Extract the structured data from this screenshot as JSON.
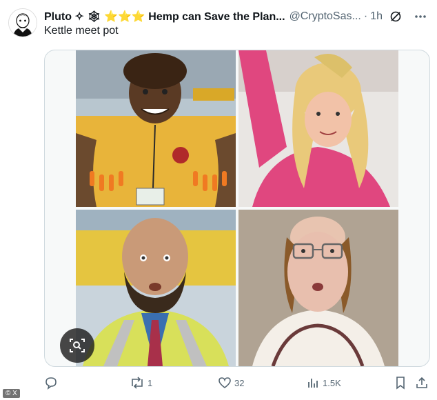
{
  "tweet": {
    "display_name": "Pluto ✧ 🕸 ⭐⭐⭐ Hemp can Save the Plan...",
    "handle": "@CryptoSas...",
    "dot": "·",
    "time": "1h",
    "text": "Kettle meet pot"
  },
  "media": {
    "photos": [
      {
        "name": "photo-top-left",
        "bg": "#e8b43a"
      },
      {
        "name": "photo-top-right",
        "bg": "#e0477f"
      },
      {
        "name": "photo-bottom-left",
        "bg": "#d8b83a"
      },
      {
        "name": "photo-bottom-right",
        "bg": "#c9b9a4"
      }
    ],
    "zoom_icon": "image-search-icon"
  },
  "actions": {
    "reply_count": "",
    "retweet_count": "1",
    "like_count": "32",
    "views_count": "1.5K"
  },
  "watermark": "© X",
  "colors": {
    "text_primary": "#0f1419",
    "text_secondary": "#536471",
    "border": "#cfd9de"
  }
}
